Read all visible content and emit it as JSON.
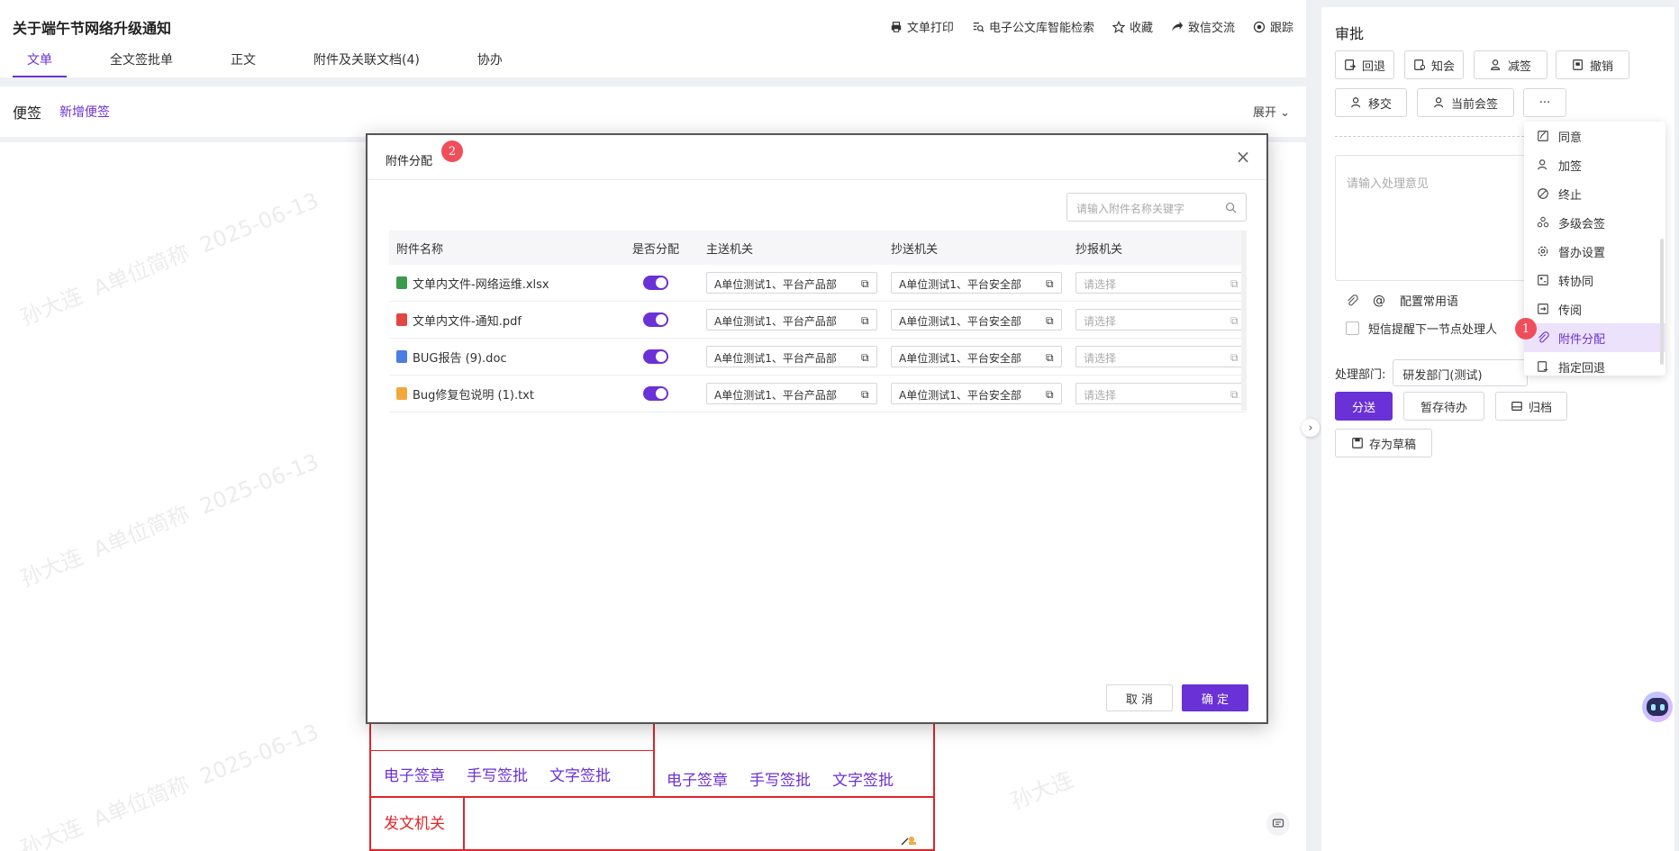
{
  "document": {
    "title": "关于端午节网络升级通知",
    "actions": [
      "文单打印",
      "电子公文库智能检索",
      "收藏",
      "致信交流",
      "跟踪"
    ],
    "tabs": [
      "文单",
      "全文签批单",
      "正文",
      "附件及关联文档(4)",
      "协办"
    ],
    "active_tab": 0,
    "notes_title": "便签",
    "notes_add": "新增便签",
    "notes_expand": "展开",
    "watermark_name": "孙大连",
    "watermark_unit": "A单位简称",
    "watermark_date": "2025-06-13",
    "sign_links": [
      "电子签章",
      "手写签批",
      "文字签批"
    ],
    "sign_label": "发文机关"
  },
  "panel": {
    "title": "审批",
    "buttons_row1": [
      "回退",
      "知会",
      "减签",
      "撤销"
    ],
    "buttons_row2": [
      "移交",
      "当前会签",
      "···"
    ],
    "opinion_placeholder": "请输入处理意见",
    "common_phrases": "配置常用语",
    "sms_label": "短信提醒下一节点处理人",
    "dept_label": "处理部门:",
    "dept_value": "研发部门(测试)",
    "send": "分送",
    "hold": "暂存待办",
    "archive": "归档",
    "draft": "存为草稿"
  },
  "menu": {
    "items": [
      "同意",
      "加签",
      "终止",
      "多级会签",
      "督办设置",
      "转协同",
      "传阅",
      "附件分配",
      "指定回退"
    ],
    "active_index": 7,
    "badge": "1"
  },
  "modal": {
    "title": "附件分配",
    "badge": "2",
    "search_placeholder": "请输入附件名称关键字",
    "columns": [
      "附件名称",
      "是否分配",
      "主送机关",
      "抄送机关",
      "抄报机关"
    ],
    "rows": [
      {
        "name": "文单内文件-网络运维.xlsx",
        "type": "xlsx",
        "assigned": true,
        "main": "A单位测试1、平台产品部",
        "cc": "A单位测试1、平台安全部",
        "report": "请选择"
      },
      {
        "name": "文单内文件-通知.pdf",
        "type": "pdf",
        "assigned": true,
        "main": "A单位测试1、平台产品部",
        "cc": "A单位测试1、平台安全部",
        "report": "请选择"
      },
      {
        "name": "BUG报告 (9).doc",
        "type": "doc",
        "assigned": true,
        "main": "A单位测试1、平台产品部",
        "cc": "A单位测试1、平台安全部",
        "report": "请选择"
      },
      {
        "name": "Bug修复包说明 (1).txt",
        "type": "txt",
        "assigned": true,
        "main": "A单位测试1、平台产品部",
        "cc": "A单位测试1、平台安全部",
        "report": "请选择"
      }
    ],
    "cancel": "取 消",
    "confirm": "确 定"
  },
  "colors": {
    "accent": "#6a31d6",
    "badge": "#f04e5a",
    "sign_red": "#e0252b",
    "xlsx": "#3c9a4b",
    "pdf": "#e3463f",
    "doc": "#4a7ee0",
    "txt": "#f2a93b"
  }
}
